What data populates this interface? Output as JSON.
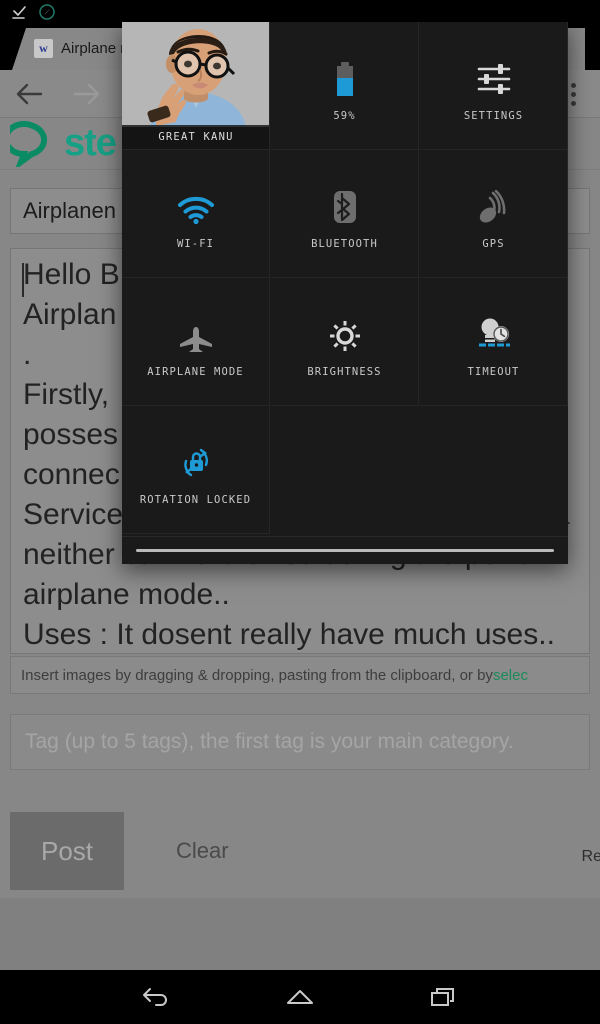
{
  "statusbar": {
    "icons": [
      {
        "name": "download-complete-icon"
      },
      {
        "name": "compass-circle-icon"
      }
    ]
  },
  "browser": {
    "tab": {
      "favicon_text": "w",
      "title": "Airplane mo"
    },
    "toolbar": {
      "back_icon": "back-arrow-icon",
      "forward_icon": "forward-arrow-icon",
      "reload_icon": "reload-icon",
      "menu_icon": "overflow-menu-icon"
    }
  },
  "site": {
    "logo_text": "ste",
    "logo_color": "#16a085"
  },
  "editor": {
    "title_value": "Airplanen",
    "body_text": "Hello B                                 o \nAirplan                              re\n.\nFirstly,                mode in a phone or tab\nposses                nost all phones to be a\nconnec                  Data Connection, hots\nService and even call services, That mea\nneither call no browse during the perio\nairplane mode..\nUses : It dosent really have much uses..",
    "image_hint_prefix": "Insert images by dragging & dropping, pasting from the clipboard, or by ",
    "image_hint_link": "selec",
    "tag_placeholder": "Tag (up to 5 tags), the first tag is your main category.",
    "post_label": "Post",
    "clear_label": "Clear",
    "resteem_label": "Re"
  },
  "quick_settings": {
    "user": {
      "name": "GREAT KANU",
      "avatar": "user-avatar"
    },
    "tiles": [
      {
        "id": "battery",
        "label": "59%",
        "icon": "battery-icon",
        "state": "on",
        "accent": "#1e9bd7"
      },
      {
        "id": "settings",
        "label": "SETTINGS",
        "icon": "sliders-icon",
        "state": "off",
        "accent": "#d8d8d8"
      },
      {
        "id": "wifi",
        "label": "WI-FI",
        "icon": "wifi-icon",
        "state": "on",
        "accent": "#1e9bd7"
      },
      {
        "id": "bluetooth",
        "label": "BLUETOOTH",
        "icon": "bluetooth-icon",
        "state": "off",
        "accent": "#6e6e6e"
      },
      {
        "id": "gps",
        "label": "GPS",
        "icon": "gps-satellite-icon",
        "state": "off",
        "accent": "#6e6e6e"
      },
      {
        "id": "airplane",
        "label": "AIRPLANE MODE",
        "icon": "airplane-icon",
        "state": "off",
        "accent": "#8c8c8c"
      },
      {
        "id": "brightness",
        "label": "BRIGHTNESS",
        "icon": "brightness-sun-icon",
        "state": "off",
        "accent": "#d8d8d8"
      },
      {
        "id": "timeout",
        "label": "TIMEOUT",
        "icon": "screen-timeout-icon",
        "state": "on",
        "accent": "#1e9bd7"
      },
      {
        "id": "rotation",
        "label": "ROTATION LOCKED",
        "icon": "rotation-lock-icon",
        "state": "on",
        "accent": "#1e9bd7"
      }
    ]
  },
  "navbar": {
    "back": "back-nav-icon",
    "home": "home-nav-icon",
    "recents": "recents-nav-icon"
  }
}
